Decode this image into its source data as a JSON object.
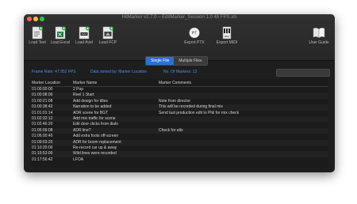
{
  "window": {
    "title": "HitMarker v2.7.0 – EditMarker_Session 1.0 48 FPS.xls"
  },
  "toolbar": {
    "buttons": [
      {
        "name": "load-text-button",
        "label": "Load Text",
        "icon": "text-file-icon"
      },
      {
        "name": "load-excel-button",
        "label": "Load Excel",
        "icon": "excel-file-icon"
      },
      {
        "name": "load-avid-button",
        "label": "Load Avid",
        "icon": "avid-file-icon"
      },
      {
        "name": "load-fcp-button",
        "label": "Load FCP",
        "icon": "fcp-file-icon"
      },
      {
        "name": "export-ptx-button",
        "label": "Export PTX",
        "icon": "ptx-export-icon"
      },
      {
        "name": "export-midi-button",
        "label": "Export MIDI",
        "icon": "midi-export-icon"
      },
      {
        "name": "user-guide-button",
        "label": "User Guide",
        "icon": "book-icon"
      }
    ]
  },
  "mode": {
    "tabs": [
      {
        "label": "Single File",
        "active": true
      },
      {
        "label": "Multiple Files",
        "active": false
      }
    ]
  },
  "info": {
    "frame_rate": "Frame Rate: 47.952 FPS",
    "sort": "Data sorted by: Marker Location",
    "count": "No. Of Markers: 13"
  },
  "table": {
    "columns": [
      "Marker Location",
      "Marker Name",
      "Marker Comments"
    ],
    "rows": [
      [
        "01:00:00:00",
        "2 Pop",
        ""
      ],
      [
        "01:00:08:00",
        "Reel 1 Start",
        ""
      ],
      [
        "01:00:21:08",
        "Add design for titles",
        "Note from director"
      ],
      [
        "01:00:38:42",
        "Narration to be added",
        "This will be recorded during final mix"
      ],
      [
        "01:01:01:14",
        "ADR scene for BGT",
        "Send last production edit to Phil for mix check"
      ],
      [
        "01:02:32:12",
        "Add mix traffic for scene",
        ""
      ],
      [
        "01:02:46:20",
        "Edit door clicks from dialo",
        ""
      ],
      [
        "01:05:09:08",
        "ADR line?",
        "Check for alts"
      ],
      [
        "01:06:00:40",
        "Add extra foots off-screen",
        ""
      ],
      [
        "01:09:03:20",
        "ADR for boom replacement",
        ""
      ],
      [
        "01:10:20:00",
        "Re-record car up & away",
        ""
      ],
      [
        "01:15:53:00",
        "Wild lines were recorded",
        ""
      ],
      [
        "01:17:56:42",
        "LFOA",
        ""
      ]
    ]
  }
}
